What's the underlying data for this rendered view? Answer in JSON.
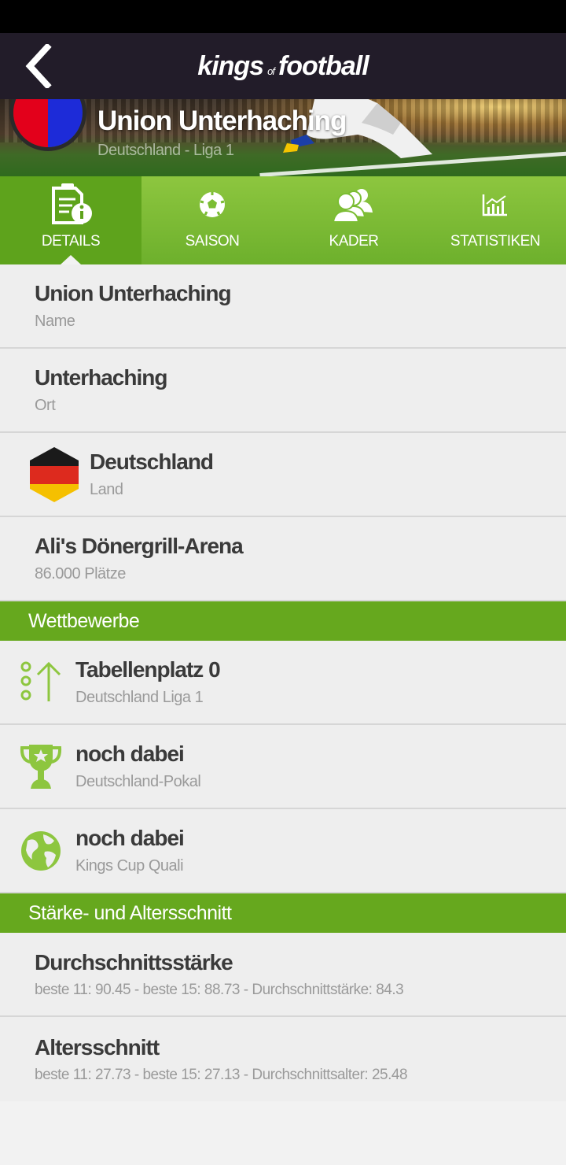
{
  "app": {
    "logo": {
      "part1": "kings",
      "part2": "of",
      "part3": "football"
    }
  },
  "hero": {
    "title": "Union Unterhaching",
    "subtitle": "Deutschland - Liga 1",
    "crest_colors": [
      "#e3001b",
      "#1d2bd8"
    ]
  },
  "tabs": [
    {
      "label": "DETAILS",
      "icon": "document-info-icon",
      "active": true
    },
    {
      "label": "SAISON",
      "icon": "soccer-ball-icon",
      "active": false
    },
    {
      "label": "KADER",
      "icon": "people-icon",
      "active": false
    },
    {
      "label": "STATISTIKEN",
      "icon": "chart-icon",
      "active": false
    }
  ],
  "details": [
    {
      "value": "Union Unterhaching",
      "label": "Name"
    },
    {
      "value": "Unterhaching",
      "label": "Ort"
    },
    {
      "value": "Deutschland",
      "label": "Land",
      "icon": "germany-flag-icon"
    },
    {
      "value": "Ali's Dönergrill-Arena",
      "label": "86.000 Plätze"
    }
  ],
  "competitions": {
    "header": "Wettbewerbe",
    "items": [
      {
        "value": "Tabellenplatz 0",
        "label": "Deutschland Liga 1",
        "icon": "rank-up-icon"
      },
      {
        "value": "noch dabei",
        "label": "Deutschland-Pokal",
        "icon": "trophy-icon"
      },
      {
        "value": "noch dabei",
        "label": "Kings Cup Quali",
        "icon": "globe-icon"
      }
    ]
  },
  "stats": {
    "header": "Stärke- und Altersschnitt",
    "items": [
      {
        "value": "Durchschnittsstärke",
        "label": "beste 11: 90.45 - beste 15: 88.73 - Durchschnittstärke: 84.3"
      },
      {
        "value": "Altersschnitt",
        "label": "beste 11: 27.73 - beste 15: 27.13 - Durchschnittsalter: 25.48"
      }
    ]
  },
  "colors": {
    "accent_green": "#66a81e",
    "icon_green": "#8dc63f",
    "app_bar": "#221c29"
  }
}
